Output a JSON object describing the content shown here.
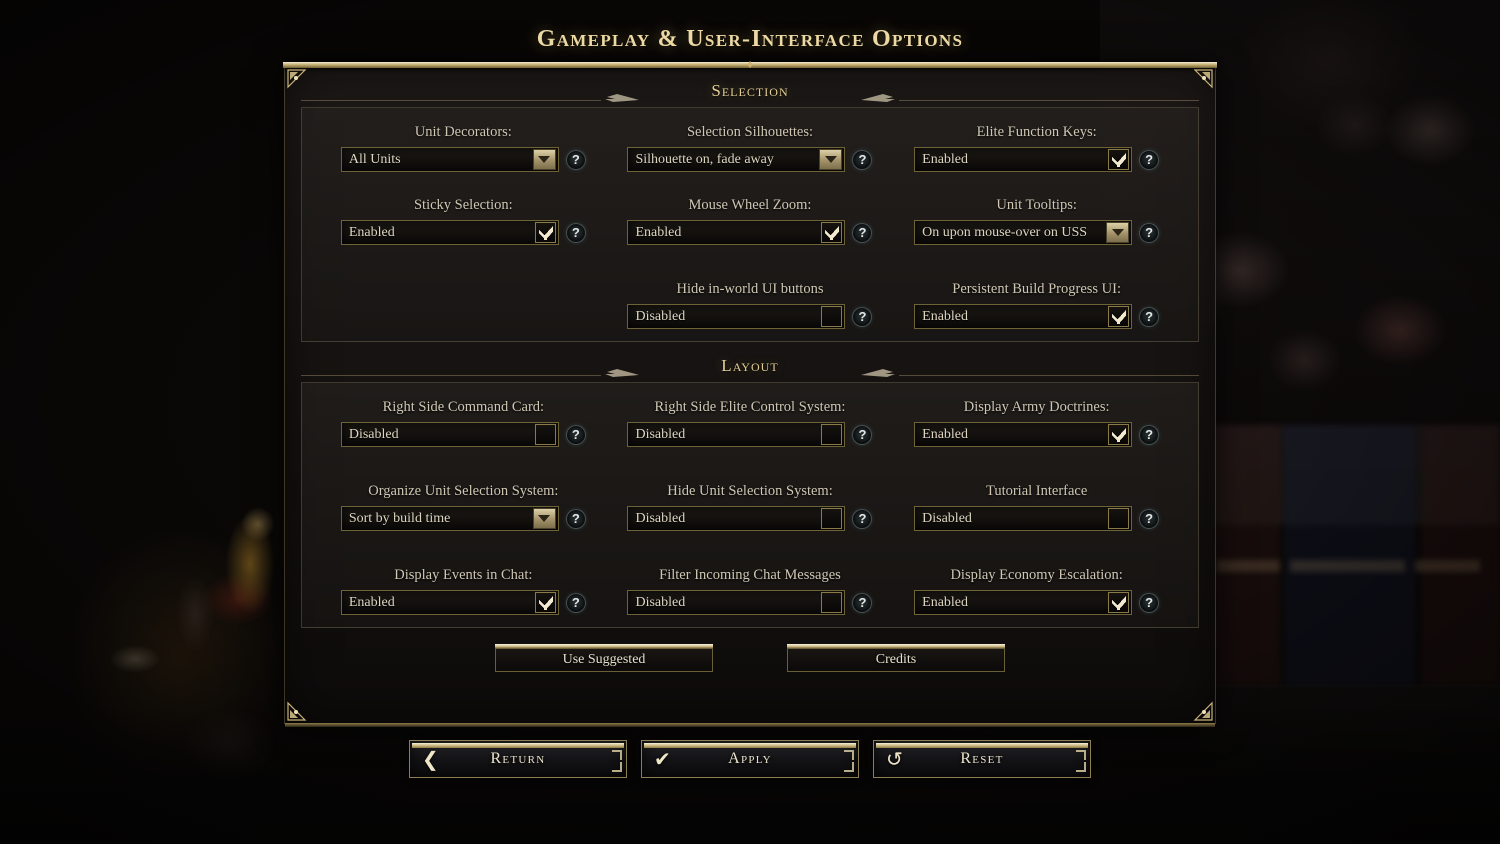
{
  "title": "Gameplay & User-Interface Options",
  "sections": [
    {
      "name": "Selection",
      "rows": [
        [
          {
            "label": "Unit Decorators:",
            "value": "All Units",
            "control": "dropdown",
            "help": "?"
          },
          {
            "label": "Selection Silhouettes:",
            "value": "Silhouette on, fade away",
            "control": "dropdown",
            "help": "?"
          },
          {
            "label": "Elite Function Keys:",
            "value": "Enabled",
            "control": "checkbox",
            "checked": true,
            "help": "?"
          }
        ],
        [
          {
            "label": "Sticky Selection:",
            "value": "Enabled",
            "control": "checkbox",
            "checked": true,
            "help": "?"
          },
          {
            "label": "Mouse Wheel Zoom:",
            "value": "Enabled",
            "control": "checkbox",
            "checked": true,
            "help": "?"
          },
          {
            "label": "Unit Tooltips:",
            "value": "On upon mouse-over on USS",
            "control": "dropdown",
            "help": "?"
          }
        ],
        [
          {
            "label": "",
            "value": "",
            "control": "none",
            "empty": true
          },
          {
            "label": "Hide in-world UI buttons",
            "value": "Disabled",
            "control": "checkbox",
            "checked": false,
            "help": "?"
          },
          {
            "label": "Persistent Build Progress UI:",
            "value": "Enabled",
            "control": "checkbox",
            "checked": true,
            "help": "?"
          }
        ]
      ]
    },
    {
      "name": "Layout",
      "rows": [
        [
          {
            "label": "Right Side Command Card:",
            "value": "Disabled",
            "control": "checkbox",
            "checked": false,
            "help": "?"
          },
          {
            "label": "Right Side Elite Control System:",
            "value": "Disabled",
            "control": "checkbox",
            "checked": false,
            "help": "?"
          },
          {
            "label": "Display Army Doctrines:",
            "value": "Enabled",
            "control": "checkbox",
            "checked": true,
            "help": "?"
          }
        ],
        [
          {
            "label": "Organize Unit Selection System:",
            "value": "Sort by build time",
            "control": "dropdown",
            "help": "?"
          },
          {
            "label": "Hide Unit Selection System:",
            "value": "Disabled",
            "control": "checkbox",
            "checked": false,
            "help": "?"
          },
          {
            "label": "Tutorial Interface",
            "value": "Disabled",
            "control": "checkbox",
            "checked": false,
            "help": "?"
          }
        ],
        [
          {
            "label": "Display Events in Chat:",
            "value": "Enabled",
            "control": "checkbox",
            "checked": true,
            "help": "?"
          },
          {
            "label": "Filter Incoming Chat Messages",
            "value": "Disabled",
            "control": "checkbox",
            "checked": false,
            "help": "?"
          },
          {
            "label": "Display Economy Escalation:",
            "value": "Enabled",
            "control": "checkbox",
            "checked": true,
            "help": "?"
          }
        ]
      ]
    }
  ],
  "mid_buttons": [
    {
      "label": "Use Suggested"
    },
    {
      "label": "Credits"
    }
  ],
  "actions": [
    {
      "label": "Return",
      "icon": "chevron-left-icon",
      "glyph": "❮"
    },
    {
      "label": "Apply",
      "icon": "check-icon",
      "glyph": "✔"
    },
    {
      "label": "Reset",
      "icon": "undo-circle-icon",
      "glyph": "↺"
    }
  ],
  "colors": {
    "gold": "#ecd9a4",
    "gold_border": "#6e6237",
    "field_text": "#ded6c2",
    "label_text": "#cfc7b4",
    "panel_bg": "#1b1814",
    "check": "#f3ead0"
  }
}
